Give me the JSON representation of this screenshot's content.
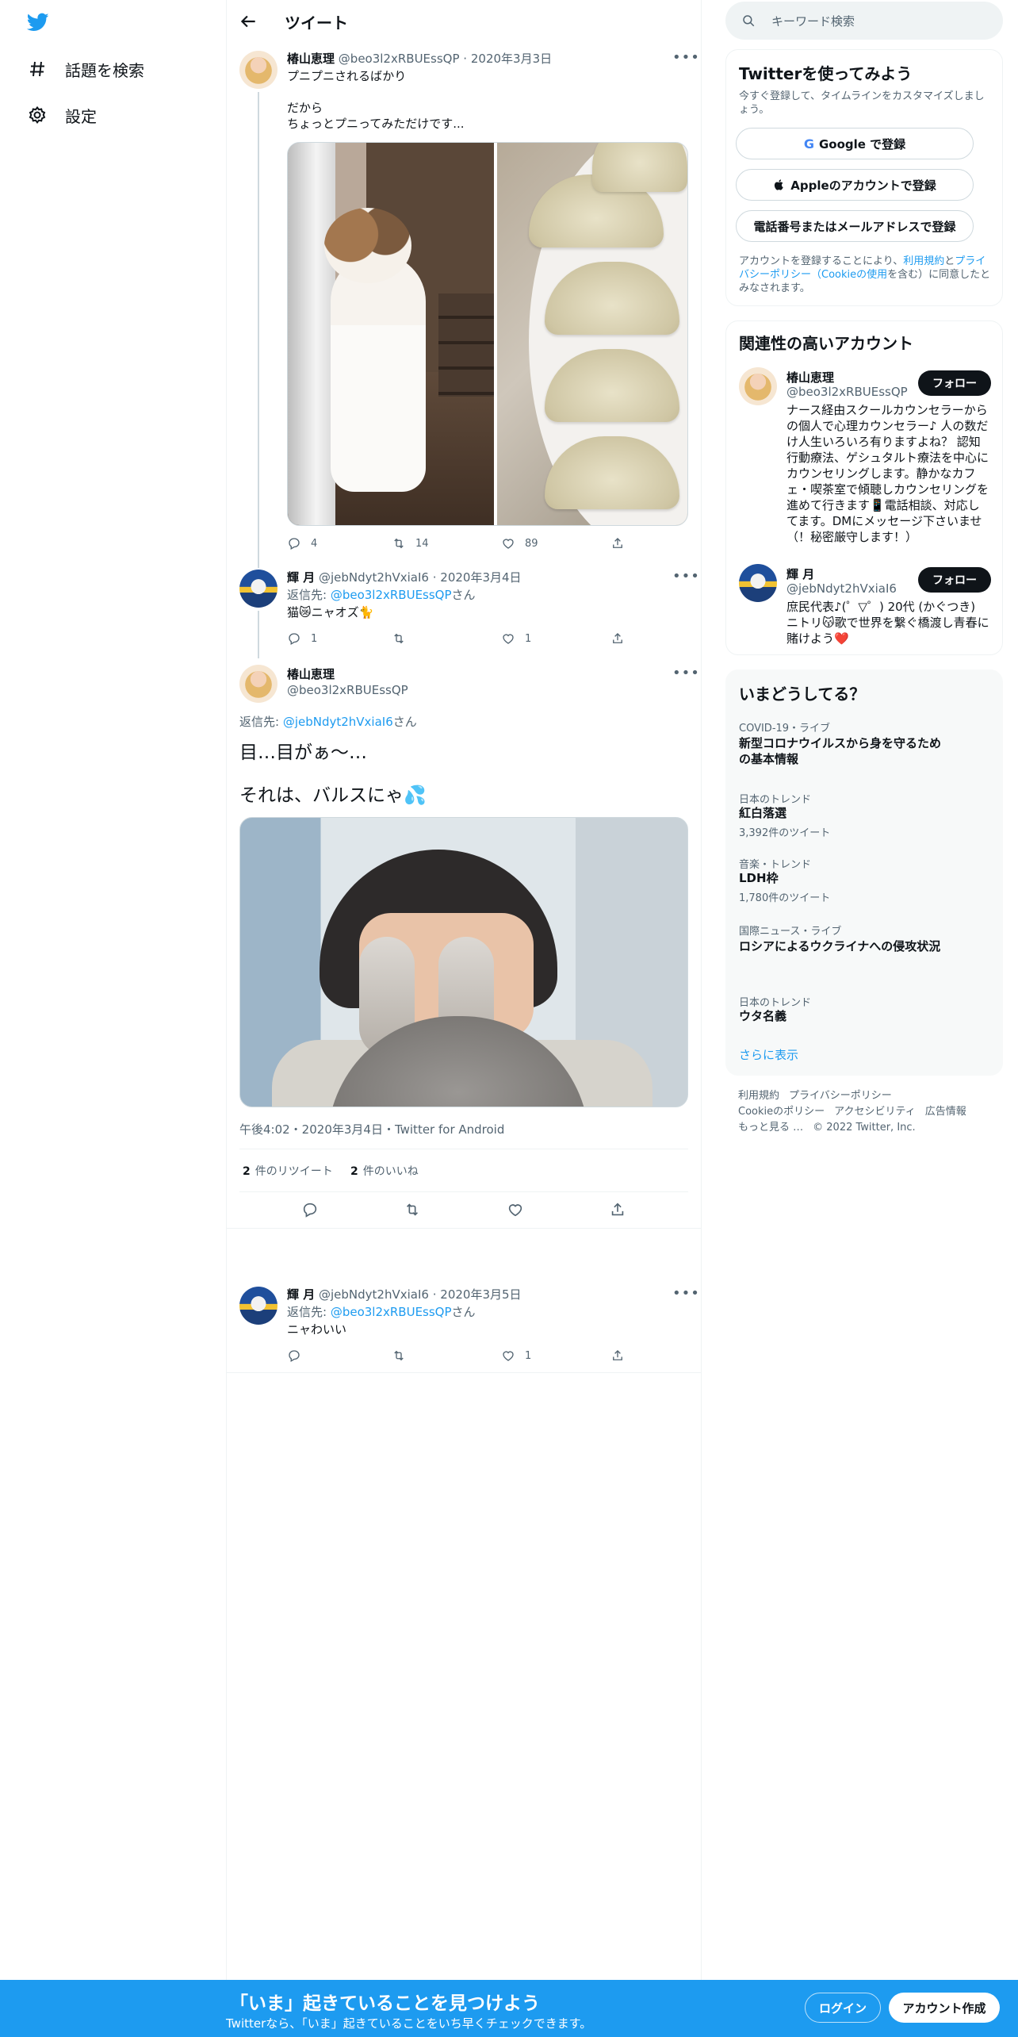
{
  "nav": {
    "logo_icon": "twitter-bird-icon",
    "items": [
      {
        "label": "話題を検索",
        "icon": "hashtag-icon"
      },
      {
        "label": "設定",
        "icon": "gear-icon"
      }
    ]
  },
  "header": {
    "title": "ツイート",
    "back_icon": "arrow-left-icon"
  },
  "tweets": [
    {
      "name": "椿山恵理",
      "handle": "@beo3l2xRBUEssQP",
      "date": "2020年3月3日",
      "lines": [
        "プニプニされるばかり",
        "",
        "だから",
        "ちょっとプニってみただけです..."
      ],
      "replies": "4",
      "retweets": "14",
      "likes": "89"
    },
    {
      "name": "輝 月",
      "handle": "@jebNdyt2hVxiaI6",
      "date": "2020年3月4日",
      "reply_to_prefix": "返信先: ",
      "reply_to_handle": "@beo3l2xRBUEssQP",
      "reply_to_suffix": "さん",
      "text": "猫😿ニャオズ🐈",
      "replies": "1",
      "retweets": "",
      "likes": "1"
    }
  ],
  "main_tweet": {
    "name": "椿山恵理",
    "handle": "@beo3l2xRBUEssQP",
    "reply_to_prefix": "返信先: ",
    "reply_to_handle": "@jebNdyt2hVxiaI6",
    "reply_to_suffix": "さん",
    "line1": "目…目がぁ～…",
    "line2": "それは、バルスにゃ💦",
    "meta": "午後4:02・2020年3月4日・Twitter for Android",
    "retweet_count": "2",
    "retweet_label": "件のリツイート",
    "like_count": "2",
    "like_label": "件のいいね"
  },
  "reply": {
    "name": "輝 月",
    "handle": "@jebNdyt2hVxiaI6",
    "date": "2020年3月5日",
    "reply_to_prefix": "返信先: ",
    "reply_to_handle": "@beo3l2xRBUEssQP",
    "reply_to_suffix": "さん",
    "text": "ニャわいい",
    "replies": "",
    "retweets": "",
    "likes": "1"
  },
  "search": {
    "placeholder": "キーワード検索"
  },
  "signup_card": {
    "title": "Twitterを使ってみよう",
    "subtitle": "今すぐ登録して、タイムラインをカスタマイズしましょう。",
    "google_label": "Google で登録",
    "apple_label": "Appleのアカウントで登録",
    "phone_label": "電話番号またはメールアドレスで登録",
    "terms_prefix": "アカウントを登録することにより、",
    "terms_link1": "利用規約",
    "terms_mid": "と",
    "terms_link2": "プライバシーポリシー（Cookieの使用",
    "terms_suffix": "を含む）に同意したとみなされます。"
  },
  "accounts_card": {
    "title": "関連性の高いアカウント",
    "accounts": [
      {
        "name": "椿山恵理",
        "handle": "@beo3l2xRBUEssQP",
        "follow_label": "フォロー",
        "bio": "ナース経由スクールカウンセラーからの個人で心理カウンセラー♪ 人の数だけ人生いろいろ有りますよね？ 認知行動療法、ゲシュタルト療法を中心にカウンセリングします。静かなカフェ・喫茶室で傾聴しカウンセリングを進めて行きます📱電話相談、対応してます。DMにメッセージ下さいませ（！秘密厳守します！）"
      },
      {
        "name": "輝 月",
        "handle": "@jebNdyt2hVxiaI6",
        "follow_label": "フォロー",
        "bio": "庶民代表♪(゜▽゜) 20代 (かぐつき) ニトリ😽歌で世界を繋ぐ橋渡し青春に賭けよう❤️"
      }
    ]
  },
  "trends_card": {
    "title": "いまどうしてる？",
    "trends": [
      {
        "category": "COVID-19・ライブ",
        "title": "新型コロナウイルスから身を守るための基本情報",
        "count": ""
      },
      {
        "category": "日本のトレンド",
        "title": "紅白落選",
        "count": "3,392件のツイート"
      },
      {
        "category": "音楽・トレンド",
        "title": "LDH枠",
        "count": "1,780件のツイート"
      },
      {
        "category": "国際ニュース・ライブ",
        "title": "ロシアによるウクライナへの侵攻状況",
        "count": ""
      },
      {
        "category": "日本のトレンド",
        "title": "ウタ名義",
        "count": ""
      }
    ],
    "show_more": "さらに表示"
  },
  "footer": {
    "links": [
      "利用規約",
      "プライバシーポリシー",
      "Cookieのポリシー",
      "アクセシビリティ",
      "広告情報",
      "もっと見る …",
      "© 2022 Twitter, Inc."
    ]
  },
  "bottom_bar": {
    "title": "「いま」起きていることを見つけよう",
    "subtitle": "Twitterなら、「いま」起きていることをいち早くチェックできます。",
    "login_label": "ログイン",
    "signup_label": "アカウント作成"
  },
  "colors": {
    "accent": "#1d9bf0",
    "text": "#0f1419",
    "muted": "#536471"
  }
}
